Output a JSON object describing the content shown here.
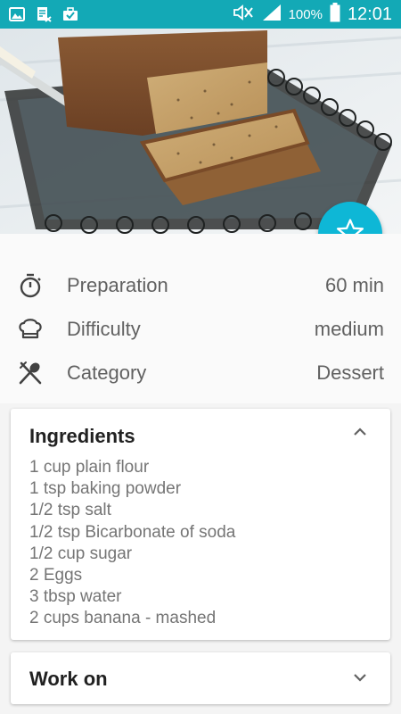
{
  "status_bar": {
    "battery": "100%",
    "time": "12:01",
    "icons": [
      "gallery-icon",
      "document-icon",
      "briefcase-icon",
      "mute-icon",
      "signal-icon",
      "battery-icon"
    ]
  },
  "hero": {
    "image": "banana-bread-photo"
  },
  "favorite": {
    "icon": "star-outline-icon"
  },
  "info": [
    {
      "icon": "timer-icon",
      "label": "Preparation",
      "value": "60 min"
    },
    {
      "icon": "chef-hat-icon",
      "label": "Difficulty",
      "value": "medium"
    },
    {
      "icon": "utensils-icon",
      "label": "Category",
      "value": "Dessert"
    }
  ],
  "ingredients": {
    "title": "Ingredients",
    "expanded": true,
    "items": [
      "1 cup plain flour",
      "1 tsp baking powder",
      "1/2 tsp salt",
      "1/2 tsp Bicarbonate of soda",
      "1/2 cup sugar",
      "2 Eggs",
      "3 tbsp water",
      "2 cups banana - mashed"
    ]
  },
  "work_on": {
    "title": "Work on",
    "expanded": false
  },
  "colors": {
    "accent": "#0eb7d6",
    "status_bar": "#13a9b6"
  }
}
